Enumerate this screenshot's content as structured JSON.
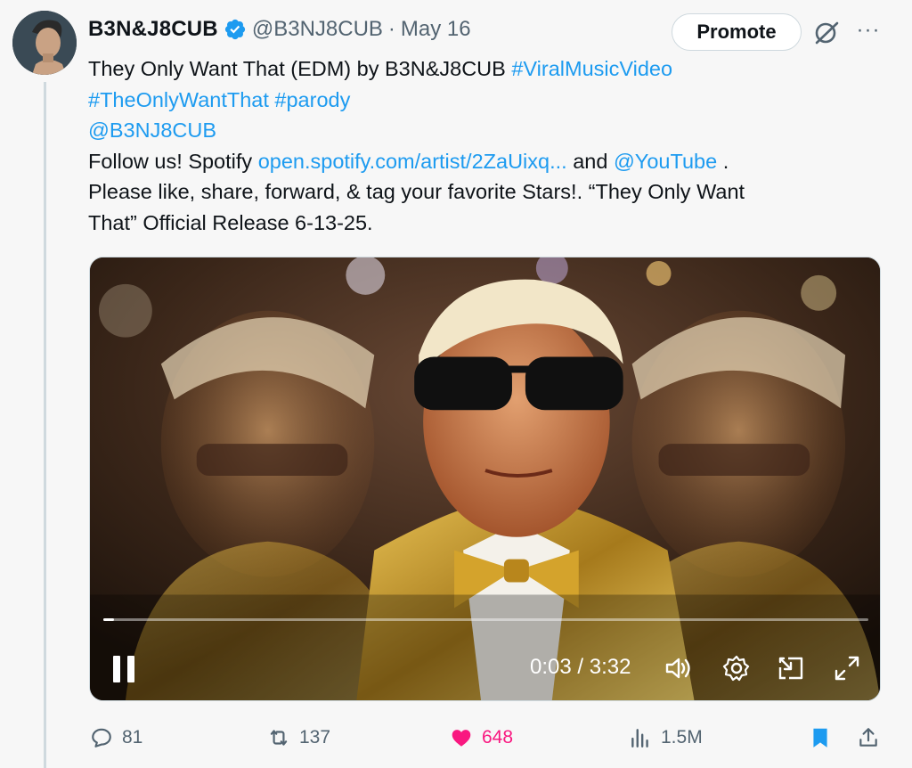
{
  "post": {
    "display_name": "B3N&J8CUB",
    "handle": "@B3NJ8CUB",
    "separator": "·",
    "date": "May 16",
    "promote_label": "Promote",
    "more_label": "···",
    "text": {
      "l1_text": "They Only Want That (EDM) by B3N&J8CUB ",
      "l1_hashtag": "#ViralMusicVideo",
      "l2_hashtags": "#TheOnlyWantThat #parody",
      "l3_mention": "@B3NJ8CUB",
      "l4_text_a": "Follow us! Spotify ",
      "l4_link": "open.spotify.com/artist/2ZaUixq...",
      "l4_text_b": " and ",
      "l4_mention": "@YouTube",
      "l4_text_c": " .",
      "l5_text": "Please like, share, forward, & tag your favorite Stars!. “They Only Want",
      "l6_text": "That” Official Release 6-13-25."
    }
  },
  "video": {
    "current_time": "0:03",
    "time_separator": " / ",
    "duration": "3:32",
    "progress_fraction": 0.014,
    "state": "playing"
  },
  "actions": {
    "replies": "81",
    "reposts": "137",
    "likes": "648",
    "views": "1.5M"
  },
  "colors": {
    "link": "#1d9bf0",
    "verified": "#1d9bf0",
    "like": "#f91880",
    "bookmark": "#1d9bf0",
    "muted": "#536471"
  },
  "icons": [
    "verified-badge-icon",
    "grok-icon",
    "more-icon",
    "pause-icon",
    "volume-icon",
    "settings-icon",
    "pip-icon",
    "fullscreen-icon",
    "reply-icon",
    "repost-icon",
    "heart-icon",
    "views-icon",
    "bookmark-icon",
    "share-icon"
  ]
}
